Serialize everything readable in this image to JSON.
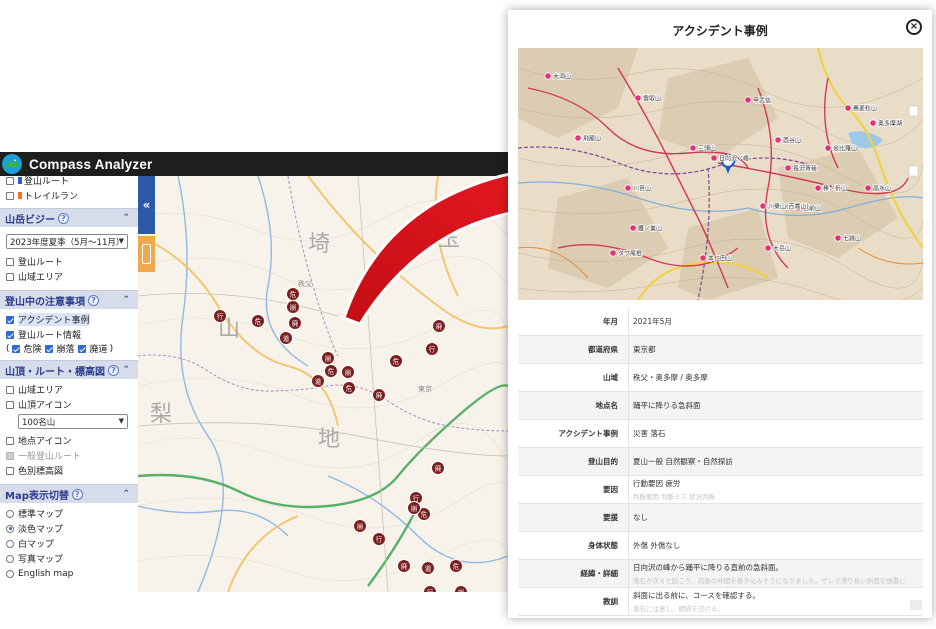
{
  "app": {
    "title": "Compass Analyzer"
  },
  "sidebar": {
    "top_items": [
      {
        "label": "登山ルート",
        "checked": false,
        "swatch": "#2f5bd6"
      },
      {
        "label": "トレイルラン",
        "checked": false,
        "swatch": "#f0702a"
      }
    ],
    "sections": {
      "mountain_busy": {
        "title": "山岳ビジー",
        "select_value": "2023年度夏季（5月～11月）",
        "items": [
          {
            "label": "登山ルート",
            "checked": false
          },
          {
            "label": "山域エリア",
            "checked": false
          }
        ]
      },
      "caution": {
        "title": "登山中の注意事項",
        "items": [
          {
            "label": "アクシデント事例",
            "checked": true
          },
          {
            "label": "登山ルート情報",
            "checked": true
          }
        ],
        "subfilters": [
          {
            "label": "危険",
            "checked": true
          },
          {
            "label": "崩落",
            "checked": true
          },
          {
            "label": "廃道",
            "checked": true
          }
        ],
        "paren_open": "(",
        "paren_close": ")"
      },
      "summit": {
        "title": "山頂・ルート・標高図",
        "items": [
          {
            "label": "山域エリア",
            "checked": false
          },
          {
            "label": "山頂アイコン",
            "checked": false
          }
        ],
        "select_value": "100名山",
        "items2": [
          {
            "label": "地点アイコン",
            "checked": false
          },
          {
            "label": "一般登山ルート",
            "checked": false,
            "disabled": true
          },
          {
            "label": "色別標高図",
            "checked": false
          }
        ]
      },
      "map_switch": {
        "title": "Map表示切替",
        "options": [
          {
            "label": "標準マップ",
            "selected": false
          },
          {
            "label": "淡色マップ",
            "selected": true
          },
          {
            "label": "白マップ",
            "selected": false
          },
          {
            "label": "写真マップ",
            "selected": false
          },
          {
            "label": "English map",
            "selected": false
          }
        ]
      }
    },
    "collapse_glyph": "«"
  },
  "map_left": {
    "place_labels": [
      "埼",
      "玉",
      "山",
      "梨",
      "地",
      "東京",
      "秩父"
    ],
    "marker_glyphs": [
      "危",
      "崩",
      "廃",
      "行",
      "道"
    ]
  },
  "modal": {
    "title": "アクシデント事例",
    "close_glyph": "×",
    "map_labels": [
      "大洞山",
      "雲取山",
      "三頭山",
      "甲武信",
      "鷹ノ巣山",
      "川苔山",
      "日向沢ノ峰",
      "大岳山",
      "御前山",
      "蕎麦粒山",
      "棒ノ折山",
      "高水山",
      "金比羅山",
      "川乗山(百尋山)",
      "本仁田山",
      "飛龍山",
      "酉谷山",
      "タワ尾根",
      "七跳山",
      "長沢背稜",
      "奥多摩湖"
    ],
    "details": [
      {
        "label": "年月",
        "value": "2021年5月"
      },
      {
        "label": "都道府県",
        "value": "東京都"
      },
      {
        "label": "山域",
        "value": "秩父・奥多摩 / 奥多摩"
      },
      {
        "label": "地点名",
        "value": "踊平に降りる急斜面"
      },
      {
        "label": "アクシデント事例",
        "value": "災害 落石"
      },
      {
        "label": "登山目的",
        "value": "夏山一般 自然観察・自然探訪"
      },
      {
        "label": "要因",
        "value": "行動要因 疲労",
        "faded": "判断要因 判断ミス 状況判断"
      },
      {
        "label": "要援",
        "value": "なし"
      },
      {
        "label": "身体状態",
        "value": "外傷 外傷なし"
      },
      {
        "label": "経緯・詳細",
        "value": "日向沢の峰から踊平に降りる直前の急斜面。",
        "faded": "落石が次々と起こり、前後の仲間を巻き込みそうになりました。ザレで滑り易い斜面を慎重に"
      },
      {
        "label": "教訓",
        "value": "斜面に出る前に、コースを確認する。",
        "faded": "落石に注意し、間隔を空ける。"
      }
    ]
  },
  "colors": {
    "header_bg": "#1e1e1e",
    "section_bg": "#d6dcea",
    "section_text": "#2b3d8f",
    "collapse_tab": "#2c5aa8",
    "side_tab": "#f0a850",
    "marker": "#7a1f1f",
    "arrow": "#e8141e",
    "map_pin": "#e0337a"
  }
}
